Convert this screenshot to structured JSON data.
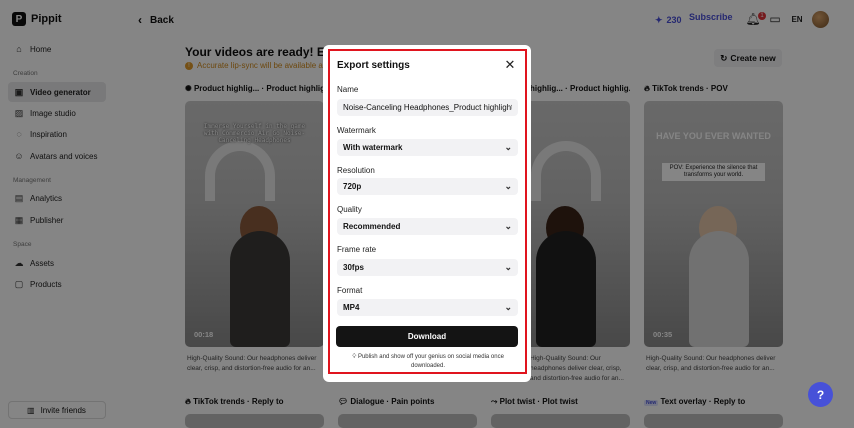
{
  "app": {
    "name": "Pippit"
  },
  "header": {
    "back_label": "Back",
    "credits": "230",
    "subscribe_label": "Subscribe",
    "notification_count": "1",
    "language_icon_text": "EN"
  },
  "sidebar": {
    "items_top": [
      {
        "label": "Home",
        "icon": "home-icon"
      }
    ],
    "creation_label": "Creation",
    "creation_items": [
      {
        "label": "Video generator",
        "icon": "video-icon"
      },
      {
        "label": "Image studio",
        "icon": "image-icon"
      },
      {
        "label": "Inspiration",
        "icon": "lightbulb-icon"
      },
      {
        "label": "Avatars and voices",
        "icon": "avatar-icon"
      }
    ],
    "management_label": "Management",
    "management_items": [
      {
        "label": "Analytics",
        "icon": "chart-icon"
      },
      {
        "label": "Publisher",
        "icon": "calendar-icon"
      }
    ],
    "space_label": "Space",
    "space_items": [
      {
        "label": "Assets",
        "icon": "cloud-icon"
      },
      {
        "label": "Products",
        "icon": "box-icon"
      }
    ],
    "invite_label": "Invite friends"
  },
  "main": {
    "title": "Your videos are ready! Expl",
    "warning": "Accurate lip-sync will be available aft",
    "create_new_label": "Create new",
    "cards": [
      {
        "title": "Product highlig... · Product highlig...",
        "duration": "00:18",
        "overlay": "Immerse Yourself in the game with Commercio Air Go Noise-Canceling Headphones",
        "description": "High-Quality Sound: Our headphones deliver clear, crisp, and distortion-free audio for an..."
      },
      {
        "title": "",
        "duration": "",
        "overlay": "",
        "description": ""
      },
      {
        "title": "highlig... · Product highlig...",
        "duration": "",
        "overlay": "",
        "description": "High-Quality Sound: Our headphones deliver clear, crisp, and distortion-free audio for an..."
      },
      {
        "title": "TikTok trends · POV",
        "duration": "00:35",
        "overlay_big": "HAVE YOU EVER WANTED",
        "overlay": "POV: Experience the silence that transforms your world.",
        "description": "High-Quality Sound: Our headphones deliver clear, crisp, and distortion-free audio for an..."
      }
    ],
    "row2_titles": [
      "TikTok trends · Reply to",
      "Dialogue · Pain points",
      "Plot twist · Plot twist",
      "Text overlay · Reply to"
    ],
    "row2_new_badge": "New"
  },
  "export": {
    "title": "Export settings",
    "name_label": "Name",
    "name_value": "Noise-Canceling Headphones_Product highlight",
    "watermark_label": "Watermark",
    "watermark_value": "With watermark",
    "resolution_label": "Resolution",
    "resolution_value": "720p",
    "quality_label": "Quality",
    "quality_value": "Recommended",
    "framerate_label": "Frame rate",
    "framerate_value": "30fps",
    "format_label": "Format",
    "format_value": "MP4",
    "download_label": "Download",
    "tip": "Publish and show off your genius on social media once downloaded."
  },
  "colors": {
    "accent": "#4751d8",
    "highlight": "#e0141e",
    "warning": "#d08a1c"
  }
}
